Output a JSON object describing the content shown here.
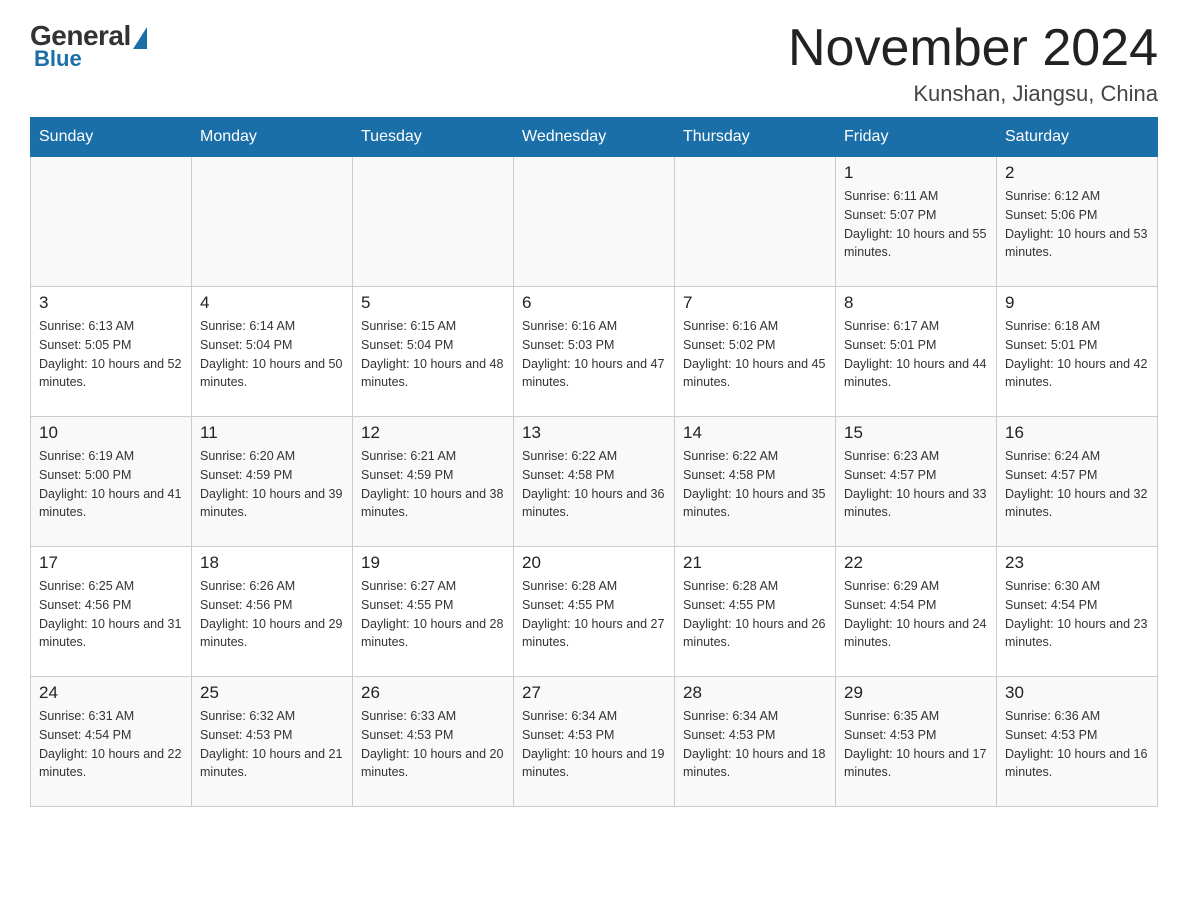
{
  "header": {
    "logo": {
      "general": "General",
      "blue": "Blue"
    },
    "title": "November 2024",
    "location": "Kunshan, Jiangsu, China"
  },
  "days_of_week": [
    "Sunday",
    "Monday",
    "Tuesday",
    "Wednesday",
    "Thursday",
    "Friday",
    "Saturday"
  ],
  "weeks": [
    [
      {
        "day": "",
        "info": ""
      },
      {
        "day": "",
        "info": ""
      },
      {
        "day": "",
        "info": ""
      },
      {
        "day": "",
        "info": ""
      },
      {
        "day": "",
        "info": ""
      },
      {
        "day": "1",
        "info": "Sunrise: 6:11 AM\nSunset: 5:07 PM\nDaylight: 10 hours and 55 minutes."
      },
      {
        "day": "2",
        "info": "Sunrise: 6:12 AM\nSunset: 5:06 PM\nDaylight: 10 hours and 53 minutes."
      }
    ],
    [
      {
        "day": "3",
        "info": "Sunrise: 6:13 AM\nSunset: 5:05 PM\nDaylight: 10 hours and 52 minutes."
      },
      {
        "day": "4",
        "info": "Sunrise: 6:14 AM\nSunset: 5:04 PM\nDaylight: 10 hours and 50 minutes."
      },
      {
        "day": "5",
        "info": "Sunrise: 6:15 AM\nSunset: 5:04 PM\nDaylight: 10 hours and 48 minutes."
      },
      {
        "day": "6",
        "info": "Sunrise: 6:16 AM\nSunset: 5:03 PM\nDaylight: 10 hours and 47 minutes."
      },
      {
        "day": "7",
        "info": "Sunrise: 6:16 AM\nSunset: 5:02 PM\nDaylight: 10 hours and 45 minutes."
      },
      {
        "day": "8",
        "info": "Sunrise: 6:17 AM\nSunset: 5:01 PM\nDaylight: 10 hours and 44 minutes."
      },
      {
        "day": "9",
        "info": "Sunrise: 6:18 AM\nSunset: 5:01 PM\nDaylight: 10 hours and 42 minutes."
      }
    ],
    [
      {
        "day": "10",
        "info": "Sunrise: 6:19 AM\nSunset: 5:00 PM\nDaylight: 10 hours and 41 minutes."
      },
      {
        "day": "11",
        "info": "Sunrise: 6:20 AM\nSunset: 4:59 PM\nDaylight: 10 hours and 39 minutes."
      },
      {
        "day": "12",
        "info": "Sunrise: 6:21 AM\nSunset: 4:59 PM\nDaylight: 10 hours and 38 minutes."
      },
      {
        "day": "13",
        "info": "Sunrise: 6:22 AM\nSunset: 4:58 PM\nDaylight: 10 hours and 36 minutes."
      },
      {
        "day": "14",
        "info": "Sunrise: 6:22 AM\nSunset: 4:58 PM\nDaylight: 10 hours and 35 minutes."
      },
      {
        "day": "15",
        "info": "Sunrise: 6:23 AM\nSunset: 4:57 PM\nDaylight: 10 hours and 33 minutes."
      },
      {
        "day": "16",
        "info": "Sunrise: 6:24 AM\nSunset: 4:57 PM\nDaylight: 10 hours and 32 minutes."
      }
    ],
    [
      {
        "day": "17",
        "info": "Sunrise: 6:25 AM\nSunset: 4:56 PM\nDaylight: 10 hours and 31 minutes."
      },
      {
        "day": "18",
        "info": "Sunrise: 6:26 AM\nSunset: 4:56 PM\nDaylight: 10 hours and 29 minutes."
      },
      {
        "day": "19",
        "info": "Sunrise: 6:27 AM\nSunset: 4:55 PM\nDaylight: 10 hours and 28 minutes."
      },
      {
        "day": "20",
        "info": "Sunrise: 6:28 AM\nSunset: 4:55 PM\nDaylight: 10 hours and 27 minutes."
      },
      {
        "day": "21",
        "info": "Sunrise: 6:28 AM\nSunset: 4:55 PM\nDaylight: 10 hours and 26 minutes."
      },
      {
        "day": "22",
        "info": "Sunrise: 6:29 AM\nSunset: 4:54 PM\nDaylight: 10 hours and 24 minutes."
      },
      {
        "day": "23",
        "info": "Sunrise: 6:30 AM\nSunset: 4:54 PM\nDaylight: 10 hours and 23 minutes."
      }
    ],
    [
      {
        "day": "24",
        "info": "Sunrise: 6:31 AM\nSunset: 4:54 PM\nDaylight: 10 hours and 22 minutes."
      },
      {
        "day": "25",
        "info": "Sunrise: 6:32 AM\nSunset: 4:53 PM\nDaylight: 10 hours and 21 minutes."
      },
      {
        "day": "26",
        "info": "Sunrise: 6:33 AM\nSunset: 4:53 PM\nDaylight: 10 hours and 20 minutes."
      },
      {
        "day": "27",
        "info": "Sunrise: 6:34 AM\nSunset: 4:53 PM\nDaylight: 10 hours and 19 minutes."
      },
      {
        "day": "28",
        "info": "Sunrise: 6:34 AM\nSunset: 4:53 PM\nDaylight: 10 hours and 18 minutes."
      },
      {
        "day": "29",
        "info": "Sunrise: 6:35 AM\nSunset: 4:53 PM\nDaylight: 10 hours and 17 minutes."
      },
      {
        "day": "30",
        "info": "Sunrise: 6:36 AM\nSunset: 4:53 PM\nDaylight: 10 hours and 16 minutes."
      }
    ]
  ]
}
